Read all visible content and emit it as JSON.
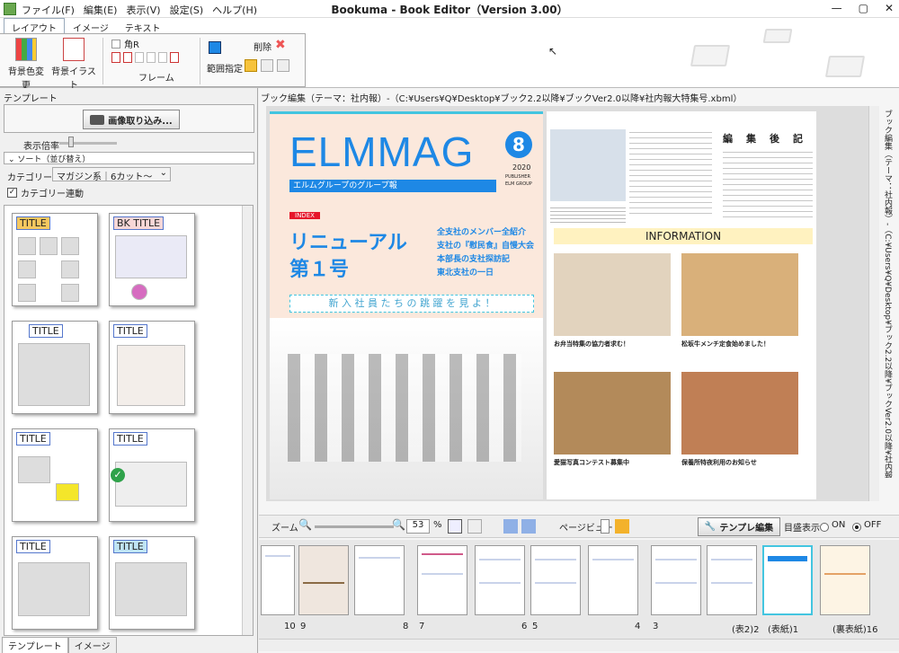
{
  "app": {
    "menu": [
      "ファイル(F)",
      "編集(E)",
      "表示(V)",
      "設定(S)",
      "ヘルプ(H)"
    ],
    "title": "Bookuma - Book Editor（Version 3.00）",
    "win_min": "—",
    "win_max": "▢",
    "win_close": "✕"
  },
  "ribbon": {
    "tabs": [
      "レイアウト",
      "イメージ",
      "テキスト"
    ],
    "bg_color_label": "背景色変更",
    "bg_illust_label": "背景イラスト",
    "corner_r_label": "角R",
    "frame_label": "フレーム",
    "range_label": "範囲指定",
    "delete_label": "削除"
  },
  "left": {
    "panel_title": "テンプレート",
    "import_label": "画像取り込み...",
    "zoom_label": "表示倍率",
    "sort_label": "ソート（並び替え）",
    "category_label": "カテゴリー",
    "category_value": "マガジン系｜6カット～",
    "category_link_label": "カテゴリー連動",
    "thumb_titles": [
      "TITLE",
      "BK TITLE",
      "TITLE",
      "TITLE",
      "TITLE",
      "TITLE",
      "TITLE",
      "TITLE"
    ],
    "bottom_tabs": [
      "テンプレート",
      "イメージ"
    ]
  },
  "doc": {
    "path": "ブック編集（テーマ：社内報）-（C:¥Users¥Q¥Desktop¥ブック2.2以降¥ブックVer2.0以降¥社内報大特集号.xbml）",
    "vertical_path": "ブック編集（テーマ：社内報）-（C:¥Users¥Q¥Desktop¥ブック2.2以降¥ブックVer2.0以降¥社内報大特集号.xbml）",
    "magazine": {
      "title": "ELMMAG",
      "issue": "8",
      "year": "2020",
      "publisher": "PUBLISHER",
      "group": "ELM GROUP",
      "subtitle": "エルムグループのグループ報",
      "index": "INDEX",
      "headline1": "リニューアル",
      "headline2": "第１号",
      "toc": [
        "全支社のメンバー全紹介",
        "支社の『慰民食』自慢大会",
        "本部長の支社探訪記",
        "東北支社の一日"
      ],
      "banner": "新 入 社 員 た ち の 跳 躍 を 見 よ ！",
      "editor_note": "編　集　後　記",
      "information": "INFORMATION",
      "caption1": "お弁当特集の協力者求む！",
      "caption2": "松坂牛メンチ定食始めました！",
      "caption3": "愛猫写真コンテスト募集中",
      "caption4": "保養所特夜利用のお知らせ"
    }
  },
  "zoombar": {
    "zoom_label": "ズーム",
    "zoom_value": "53",
    "percent": "%",
    "page_view_label": "ページビュー",
    "template_edit_label": "テンプレ編集",
    "grid_label": "目盛表示",
    "on_label": "ON",
    "off_label": "OFF"
  },
  "strip": {
    "labels": [
      "10",
      "9",
      "8",
      "7",
      "6",
      "5",
      "4",
      "3",
      "(表2)2",
      "(表紙)1",
      "(裏表紙)16"
    ]
  },
  "colors": {
    "accent_blue": "#1e88e5",
    "magazine_bg": "#fbe8dc",
    "info_band": "#fff2c0"
  }
}
